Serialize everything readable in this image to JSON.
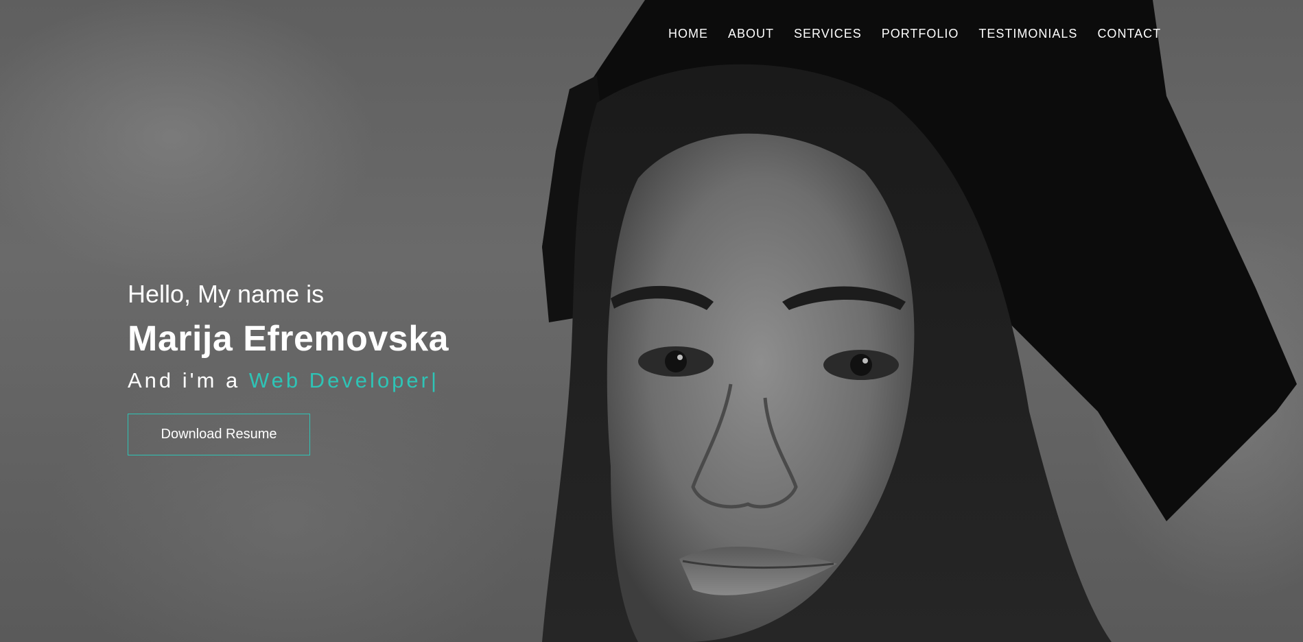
{
  "nav": {
    "items": [
      {
        "label": "HOME"
      },
      {
        "label": "ABOUT"
      },
      {
        "label": "SERVICES"
      },
      {
        "label": "PORTFOLIO"
      },
      {
        "label": "TESTIMONIALS"
      },
      {
        "label": "CONTACT"
      }
    ]
  },
  "hero": {
    "greeting": "Hello, My name is",
    "name": "Marija Efremovska",
    "role_prefix": "And i'm a",
    "role_typed": "Web Developer",
    "cursor": "|",
    "download_label": "Download Resume"
  },
  "colors": {
    "accent": "#2ec4b6",
    "text": "#ffffff",
    "background": "#5f5f5f"
  }
}
